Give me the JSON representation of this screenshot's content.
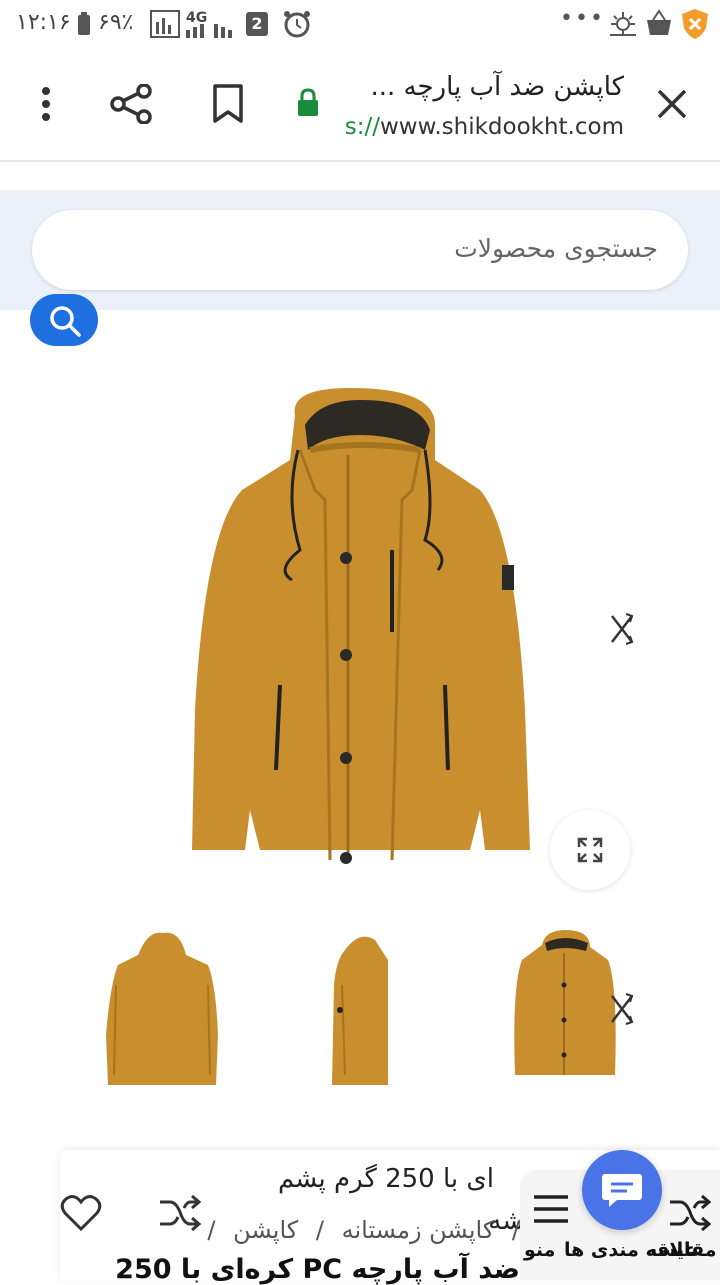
{
  "status_bar": {
    "time": "۱۲:۱۶",
    "battery": "۶۹٪",
    "network": "4G",
    "notification_count": "2",
    "more": "•••"
  },
  "browser": {
    "page_title": "کاپشن ضد آب پارچه ...",
    "url_scheme": "s://",
    "url_host": "www.shikdookht.com"
  },
  "search": {
    "placeholder": "جستجوی محصولات"
  },
  "product": {
    "title_line1": "ای با 250 گرم پشم",
    "title_line2": "شه",
    "breadcrumb": [
      "کاپشن زمستانه",
      "کاپشن"
    ],
    "breadcrumb_sep": "/",
    "full_title": "ضد آب پارچه PC کره‌ای با 250"
  },
  "bottom_nav": {
    "compare_label": "مقایسه",
    "wishlist_label": "علاقه مندی ها",
    "menu_label": "منو"
  },
  "colors": {
    "accent": "#1e6fe0",
    "jacket": "#c98f2e",
    "chat": "#4a73e8",
    "lock": "#1a8a3b"
  }
}
